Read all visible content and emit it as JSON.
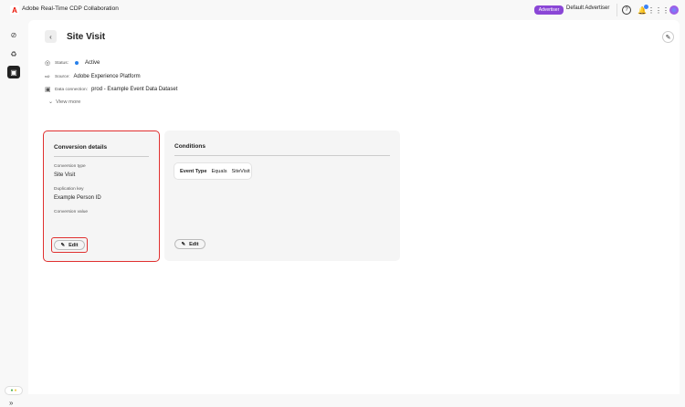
{
  "header": {
    "app_title": "Adobe Real-Time CDP Collaboration",
    "role_badge": "Advertiser",
    "account_name": "Default Advertiser"
  },
  "page": {
    "title": "Site Visit",
    "status_label": "Status:",
    "status_value": "Active",
    "source_label": "Source:",
    "source_value": "Adobe Experience Platform",
    "connection_label": "Data connection:",
    "connection_value": "prod - Example Event Data Dataset",
    "view_more": "View more"
  },
  "conversion": {
    "title": "Conversion details",
    "type_label": "Conversion type",
    "type_value": "Site Visit",
    "dedup_label": "Duplication key",
    "dedup_value": "Example Person ID",
    "value_label": "Conversion value",
    "edit_label": "Edit"
  },
  "conditions": {
    "title": "Conditions",
    "field": "Event Type",
    "operator": "Equals",
    "value": "SiteVisit",
    "edit_label": "Edit"
  },
  "colors": {
    "accent": "#8a46d6",
    "highlight": "#e0302f",
    "status": "#2680eb"
  }
}
